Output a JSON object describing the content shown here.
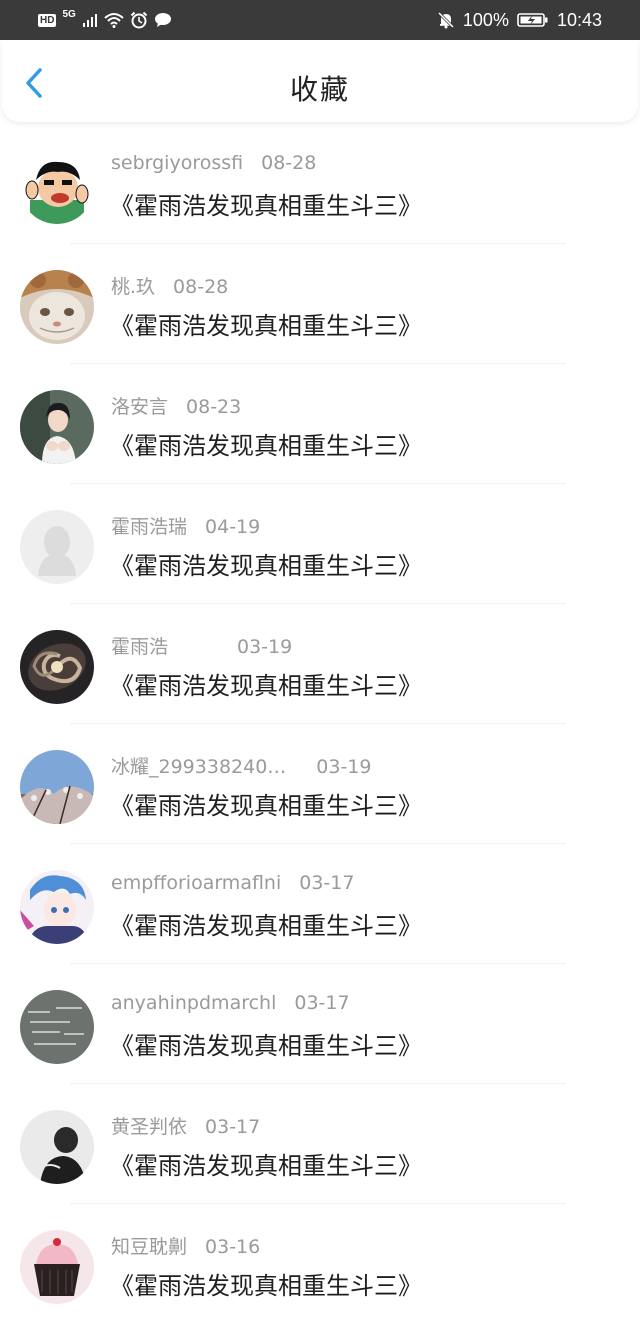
{
  "status_bar": {
    "hd": "HD",
    "network": "5G",
    "battery_percent": "100%",
    "time": "10:43"
  },
  "header": {
    "title": "收藏"
  },
  "items": [
    {
      "name": "sebrgiyorossfi",
      "date": "08-28",
      "title": "《霍雨浩发现真相重生斗三》"
    },
    {
      "name": "桃.玖",
      "date": "08-28",
      "title": "《霍雨浩发现真相重生斗三》"
    },
    {
      "name": "洛安言",
      "date": "08-23",
      "title": "《霍雨浩发现真相重生斗三》"
    },
    {
      "name": "霍雨浩瑞",
      "date": "04-19",
      "title": "《霍雨浩发现真相重生斗三》"
    },
    {
      "name": "霍雨浩",
      "date": "03-19",
      "title": "《霍雨浩发现真相重生斗三》"
    },
    {
      "name": "冰耀_299338240…",
      "date": "03-19",
      "title": "《霍雨浩发现真相重生斗三》"
    },
    {
      "name": "empfforioarmaflni",
      "date": "03-17",
      "title": "《霍雨浩发现真相重生斗三》"
    },
    {
      "name": "anyahinpdmarchl",
      "date": "03-17",
      "title": "《霍雨浩发现真相重生斗三》"
    },
    {
      "name": "黄圣判依",
      "date": "03-17",
      "title": "《霍雨浩发现真相重生斗三》"
    },
    {
      "name": "知豆耽劓",
      "date": "03-16",
      "title": "《霍雨浩发现真相重生斗三》"
    }
  ],
  "colors": {
    "accent": "#2f9bea",
    "status_bar_bg": "#3a3a3a",
    "meta_text": "#9a9a9a",
    "title_text": "#1f1f1f"
  }
}
